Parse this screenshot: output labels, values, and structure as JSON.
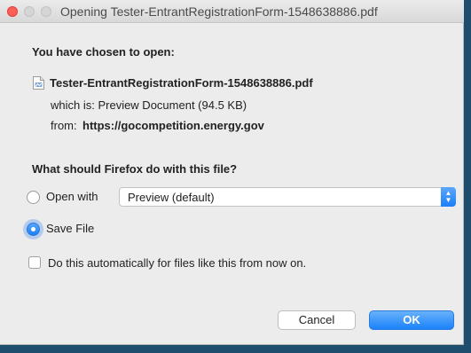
{
  "window": {
    "title": "Opening Tester-EntrantRegistrationForm-1548638886.pdf"
  },
  "dialog": {
    "heading": "You have chosen to open:",
    "filename": "Tester-EntrantRegistrationForm-1548638886.pdf",
    "which_is": "which is: Preview Document (94.5 KB)",
    "from_label": "from:",
    "from_url": "https://gocompetition.energy.gov",
    "question": "What should Firefox do with this file?",
    "open_with_label": "Open with",
    "open_with_app": "Preview (default)",
    "save_file_label": "Save File",
    "auto_label": "Do this automatically for files like this from now on.",
    "cancel_label": "Cancel",
    "ok_label": "OK",
    "selected_option": "save_file",
    "auto_checked": false
  },
  "colors": {
    "accent": "#1b7ff7",
    "close_button": "#fc5f57",
    "window_bg": "#ececec"
  },
  "icons": {
    "file": "pdf-document-icon",
    "dropdown": "up-down-arrows-icon"
  }
}
